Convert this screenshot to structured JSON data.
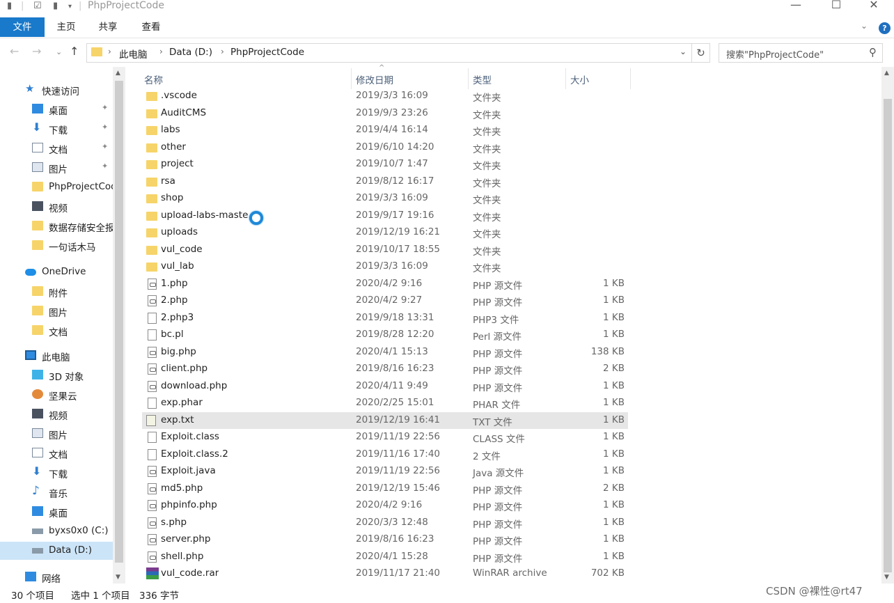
{
  "window": {
    "title": "PhpProjectCode",
    "minimize": "—",
    "maximize": "☐",
    "close": "✕"
  },
  "ribbon": {
    "tabs": [
      "文件",
      "主页",
      "共享",
      "查看"
    ],
    "help": "?"
  },
  "nav": {
    "back": "←",
    "forward": "→",
    "up": "↑",
    "breadcrumb": [
      "此电脑",
      "Data (D:)",
      "PhpProjectCode"
    ],
    "refresh": "↻",
    "search_placeholder": "搜索\"PhpProjectCode\""
  },
  "sidebar": {
    "items": [
      {
        "label": "快速访问",
        "icon": "star-icon",
        "pinned": false
      },
      {
        "label": "桌面",
        "icon": "desktop-icon",
        "pinned": true
      },
      {
        "label": "下载",
        "icon": "download-icon",
        "pinned": true
      },
      {
        "label": "文档",
        "icon": "document-icon",
        "pinned": true
      },
      {
        "label": "图片",
        "icon": "picture-icon",
        "pinned": true
      },
      {
        "label": "PhpProjectCod",
        "icon": "folder-icon",
        "pinned": false
      },
      {
        "label": "视频",
        "icon": "video-icon",
        "pinned": false
      },
      {
        "label": "数据存储安全报",
        "icon": "folder-icon",
        "pinned": false
      },
      {
        "label": "一句话木马",
        "icon": "folder-icon",
        "pinned": false
      },
      {
        "label": "OneDrive",
        "icon": "cloud-icon",
        "pinned": false
      },
      {
        "label": "附件",
        "icon": "folder-icon",
        "pinned": false
      },
      {
        "label": "图片",
        "icon": "folder-icon",
        "pinned": false
      },
      {
        "label": "文档",
        "icon": "folder-icon",
        "pinned": false
      },
      {
        "label": "此电脑",
        "icon": "computer-icon",
        "pinned": false
      },
      {
        "label": "3D 对象",
        "icon": "3d-objects-icon",
        "pinned": false
      },
      {
        "label": "坚果云",
        "icon": "nutstore-icon",
        "pinned": false
      },
      {
        "label": "视频",
        "icon": "video-icon",
        "pinned": false
      },
      {
        "label": "图片",
        "icon": "picture-icon",
        "pinned": false
      },
      {
        "label": "文档",
        "icon": "document-icon",
        "pinned": false
      },
      {
        "label": "下载",
        "icon": "download-icon",
        "pinned": false
      },
      {
        "label": "音乐",
        "icon": "music-icon",
        "pinned": false
      },
      {
        "label": "桌面",
        "icon": "desktop-icon",
        "pinned": false
      },
      {
        "label": "byxs0x0 (C:)",
        "icon": "drive-icon",
        "pinned": false
      },
      {
        "label": "Data (D:)",
        "icon": "drive-icon",
        "pinned": false,
        "selected": true
      },
      {
        "label": "网络",
        "icon": "network-icon",
        "pinned": false
      }
    ]
  },
  "columns": {
    "name": "名称",
    "date": "修改日期",
    "type": "类型",
    "size": "大小"
  },
  "files": [
    {
      "name": ".vscode",
      "date": "2019/3/3 16:09",
      "type": "文件夹",
      "size": "",
      "kind": "folder"
    },
    {
      "name": "AuditCMS",
      "date": "2019/9/3 23:26",
      "type": "文件夹",
      "size": "",
      "kind": "folder"
    },
    {
      "name": "labs",
      "date": "2019/4/4 16:14",
      "type": "文件夹",
      "size": "",
      "kind": "folder"
    },
    {
      "name": "other",
      "date": "2019/6/10 14:20",
      "type": "文件夹",
      "size": "",
      "kind": "folder"
    },
    {
      "name": "project",
      "date": "2019/10/7 1:47",
      "type": "文件夹",
      "size": "",
      "kind": "folder"
    },
    {
      "name": "rsa",
      "date": "2019/8/12 16:17",
      "type": "文件夹",
      "size": "",
      "kind": "folder"
    },
    {
      "name": "shop",
      "date": "2019/3/3 16:09",
      "type": "文件夹",
      "size": "",
      "kind": "folder"
    },
    {
      "name": "upload-labs-maste",
      "date": "2019/9/17 19:16",
      "type": "文件夹",
      "size": "",
      "kind": "folder"
    },
    {
      "name": "uploads",
      "date": "2019/12/19 16:21",
      "type": "文件夹",
      "size": "",
      "kind": "folder"
    },
    {
      "name": "vul_code",
      "date": "2019/10/17 18:55",
      "type": "文件夹",
      "size": "",
      "kind": "folder"
    },
    {
      "name": "vul_lab",
      "date": "2019/3/3 16:09",
      "type": "文件夹",
      "size": "",
      "kind": "folder"
    },
    {
      "name": "1.php",
      "date": "2020/4/2 9:16",
      "type": "PHP 源文件",
      "size": "1 KB",
      "kind": "php"
    },
    {
      "name": "2.php",
      "date": "2020/4/2 9:27",
      "type": "PHP 源文件",
      "size": "1 KB",
      "kind": "php"
    },
    {
      "name": "2.php3",
      "date": "2019/9/18 13:31",
      "type": "PHP3 文件",
      "size": "1 KB",
      "kind": "file"
    },
    {
      "name": "bc.pl",
      "date": "2019/8/28 12:20",
      "type": "Perl 源文件",
      "size": "1 KB",
      "kind": "file"
    },
    {
      "name": "big.php",
      "date": "2020/4/1 15:13",
      "type": "PHP 源文件",
      "size": "138 KB",
      "kind": "php"
    },
    {
      "name": "client.php",
      "date": "2019/8/16 16:23",
      "type": "PHP 源文件",
      "size": "2 KB",
      "kind": "php"
    },
    {
      "name": "download.php",
      "date": "2020/4/11 9:49",
      "type": "PHP 源文件",
      "size": "1 KB",
      "kind": "php"
    },
    {
      "name": "exp.phar",
      "date": "2020/2/25 15:01",
      "type": "PHAR 文件",
      "size": "1 KB",
      "kind": "file"
    },
    {
      "name": "exp.txt",
      "date": "2019/12/19 16:41",
      "type": "TXT 文件",
      "size": "1 KB",
      "kind": "txt",
      "highlighted": true
    },
    {
      "name": "Exploit.class",
      "date": "2019/11/19 22:56",
      "type": "CLASS 文件",
      "size": "1 KB",
      "kind": "file"
    },
    {
      "name": "Exploit.class.2",
      "date": "2019/11/16 17:40",
      "type": "2 文件",
      "size": "1 KB",
      "kind": "file"
    },
    {
      "name": "Exploit.java",
      "date": "2019/11/19 22:56",
      "type": "Java 源文件",
      "size": "1 KB",
      "kind": "php"
    },
    {
      "name": "md5.php",
      "date": "2019/12/19 15:46",
      "type": "PHP 源文件",
      "size": "2 KB",
      "kind": "php"
    },
    {
      "name": "phpinfo.php",
      "date": "2020/4/2 9:16",
      "type": "PHP 源文件",
      "size": "1 KB",
      "kind": "php"
    },
    {
      "name": "s.php",
      "date": "2020/3/3 12:48",
      "type": "PHP 源文件",
      "size": "1 KB",
      "kind": "php"
    },
    {
      "name": "server.php",
      "date": "2019/8/16 16:23",
      "type": "PHP 源文件",
      "size": "1 KB",
      "kind": "php"
    },
    {
      "name": "shell.php",
      "date": "2020/4/1 15:28",
      "type": "PHP 源文件",
      "size": "1 KB",
      "kind": "php"
    },
    {
      "name": "vul_code.rar",
      "date": "2019/11/17 21:40",
      "type": "WinRAR archive",
      "size": "702 KB",
      "kind": "rar"
    }
  ],
  "status": {
    "count": "30 个项目",
    "selection": "选中 1 个项目",
    "size": "336 字节"
  },
  "watermark": "CSDN @裸性@rt47"
}
